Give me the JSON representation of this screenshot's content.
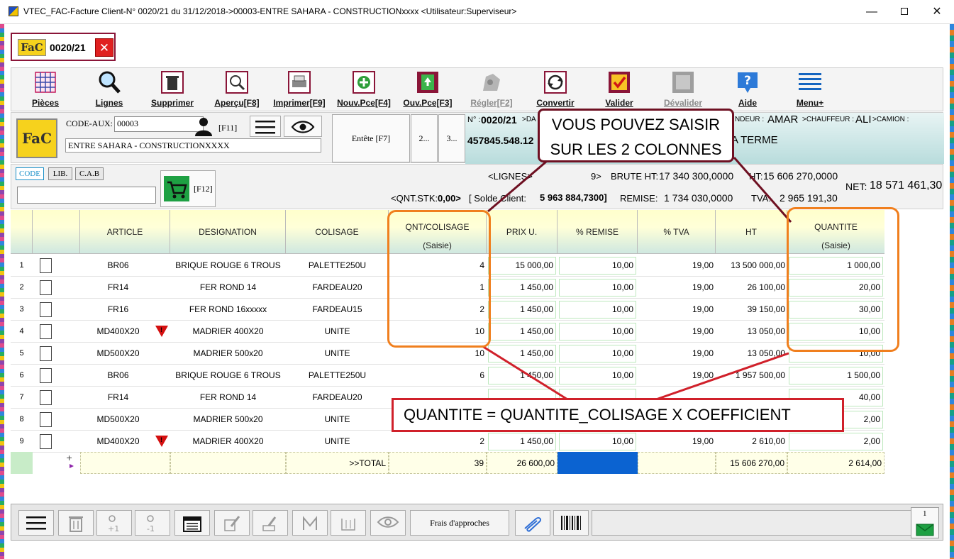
{
  "window": {
    "title": "VTEC_FAC-Facture Client-N° 0020/21 du 31/12/2018->00003-ENTRE SAHARA - CONSTRUCTIONxxxx <Utilisateur:Superviseur>",
    "minimize": "—",
    "close": "✕"
  },
  "doc_tab": {
    "logo": "FaC",
    "number": "0020/21",
    "close": "✕"
  },
  "toolbar": {
    "items": [
      {
        "label": "Pièces",
        "icon": "grid-icon"
      },
      {
        "label": "Lignes",
        "icon": "magnifier-icon"
      },
      {
        "label": "Supprimer",
        "icon": "trash-icon"
      },
      {
        "label": "Aperçu[F8]",
        "icon": "preview-icon"
      },
      {
        "label": "Imprimer[F9]",
        "icon": "printer-icon"
      },
      {
        "label": "Nouv.Pce[F4]",
        "icon": "plus-circle-icon"
      },
      {
        "label": "Ouv.Pce[F3]",
        "icon": "open-icon"
      },
      {
        "label": "Régler[F2]",
        "icon": "pay-icon"
      },
      {
        "label": "Convertir",
        "icon": "convert-icon"
      },
      {
        "label": "Valider",
        "icon": "check-icon"
      },
      {
        "label": "Dévalider",
        "icon": "unvalidate-icon"
      },
      {
        "label": "Aide",
        "icon": "help-icon"
      },
      {
        "label": "Menu+",
        "icon": "menu-icon"
      }
    ]
  },
  "header": {
    "logo": "FaC",
    "code_aux_label": "CODE-AUX:",
    "code_aux_value": "00003",
    "client_name": "ENTRE SAHARA - CONSTRUCTIONXXXX",
    "f11": "[F11]",
    "entete_btn": "Entête [F7]",
    "btn2": "2...",
    "btn3": "3...",
    "num_label": "N° :",
    "num_value": "0020/21",
    "da_label": ">DA",
    "account": "457845.548.12",
    "vendeur_label": "NDEUR :",
    "vendeur_value": "AMAR",
    "chauffeur_label": ">CHAUFFEUR :",
    "chauffeur_value": "ALI",
    "camion_label": ">CAMION :",
    "terme": "A TERME"
  },
  "code_panel": {
    "tabs": [
      "CODE",
      "LIB.",
      "C.A.B"
    ],
    "f12": "[F12]"
  },
  "totals": {
    "lignes_label": "<LIGNES>",
    "lignes_value": "9>",
    "brute_label": "BRUTE HT:",
    "brute_value": "17 340 300,0000",
    "ht_label": "HT:",
    "ht_value": "15 606 270,0000",
    "net_label": "NET:",
    "net_value": "18 571 461,30",
    "qnt_stk_label": "<QNT.STK:",
    "qnt_stk_value": "0,00>",
    "solde_label": "[ Solde Client:",
    "solde_value": "5 963 884,7300]",
    "remise_label": "REMISE:",
    "remise_value": "1 734 030,0000",
    "tva_label": "TVA:",
    "tva_value": "2 965 191,30"
  },
  "grid": {
    "columns": {
      "article": "ARTICLE",
      "designation": "DESIGNATION",
      "colisage": "COLISAGE",
      "qnt_colisage": "QNT/COLISAGE",
      "qnt_colisage_sub": "(Saisie)",
      "prix": "PRIX U.",
      "remise": "% REMISE",
      "tva": "% TVA",
      "ht": "HT",
      "quantite": "QUANTITE",
      "quantite_sub": "(Saisie)"
    },
    "rows": [
      {
        "n": "1",
        "article": "BR06",
        "warn": false,
        "designation": "BRIQUE ROUGE 6 TROUS",
        "colisage": "PALETTE250U",
        "qc": "4",
        "prix": "15 000,00",
        "remise": "10,00",
        "tva": "19,00",
        "ht": "13 500 000,00",
        "qte": "1 000,00"
      },
      {
        "n": "2",
        "article": "FR14",
        "warn": false,
        "designation": "FER ROND 14",
        "colisage": "FARDEAU20",
        "qc": "1",
        "prix": "1 450,00",
        "remise": "10,00",
        "tva": "19,00",
        "ht": "26 100,00",
        "qte": "20,00"
      },
      {
        "n": "3",
        "article": "FR16",
        "warn": false,
        "designation": "FER ROND 16xxxxx",
        "colisage": "FARDEAU15",
        "qc": "2",
        "prix": "1 450,00",
        "remise": "10,00",
        "tva": "19,00",
        "ht": "39 150,00",
        "qte": "30,00"
      },
      {
        "n": "4",
        "article": "MD400X20",
        "warn": true,
        "designation": "MADRIER 400X20",
        "colisage": "UNITE",
        "qc": "10",
        "prix": "1 450,00",
        "remise": "10,00",
        "tva": "19,00",
        "ht": "13 050,00",
        "qte": "10,00"
      },
      {
        "n": "5",
        "article": "MD500X20",
        "warn": false,
        "designation": "MADRIER 500x20",
        "colisage": "UNITE",
        "qc": "10",
        "prix": "1 450,00",
        "remise": "10,00",
        "tva": "19,00",
        "ht": "13 050,00",
        "qte": "10,00"
      },
      {
        "n": "6",
        "article": "BR06",
        "warn": false,
        "designation": "BRIQUE ROUGE 6 TROUS",
        "colisage": "PALETTE250U",
        "qc": "6",
        "prix": "1 450,00",
        "remise": "10,00",
        "tva": "19,00",
        "ht": "1 957 500,00",
        "qte": "1 500,00"
      },
      {
        "n": "7",
        "article": "FR14",
        "warn": false,
        "designation": "FER ROND 14",
        "colisage": "FARDEAU20",
        "qc": "",
        "prix": "",
        "remise": "",
        "tva": "",
        "ht": "",
        "qte": "40,00"
      },
      {
        "n": "8",
        "article": "MD500X20",
        "warn": false,
        "designation": "MADRIER 500x20",
        "colisage": "UNITE",
        "qc": "",
        "prix": "",
        "remise": "",
        "tva": "",
        "ht": "",
        "qte": "2,00"
      },
      {
        "n": "9",
        "article": "MD400X20",
        "warn": true,
        "designation": "MADRIER 400X20",
        "colisage": "UNITE",
        "qc": "2",
        "prix": "1 450,00",
        "remise": "10,00",
        "tva": "19,00",
        "ht": "2 610,00",
        "qte": "2,00"
      }
    ],
    "total": {
      "label": ">>TOTAL",
      "qc": "39",
      "prix": "26 600,00",
      "ht": "15 606 270,00",
      "qte": "2 614,00"
    }
  },
  "annotations": {
    "top_line1": "VOUS POUVEZ SAISIR",
    "top_line2": "SUR LES 2 COLONNES",
    "bottom": "QUANTITE = QUANTITE_COLISAGE  X COEFFICIENT"
  },
  "bottom_bar": {
    "frais": "Frais d'approches",
    "mail_count": "1"
  },
  "colors": {
    "callout_top": "#6e1022",
    "orange": "#f07f1e",
    "callout_bottom": "#d0202a",
    "selected_cell": "#0b63d1"
  }
}
